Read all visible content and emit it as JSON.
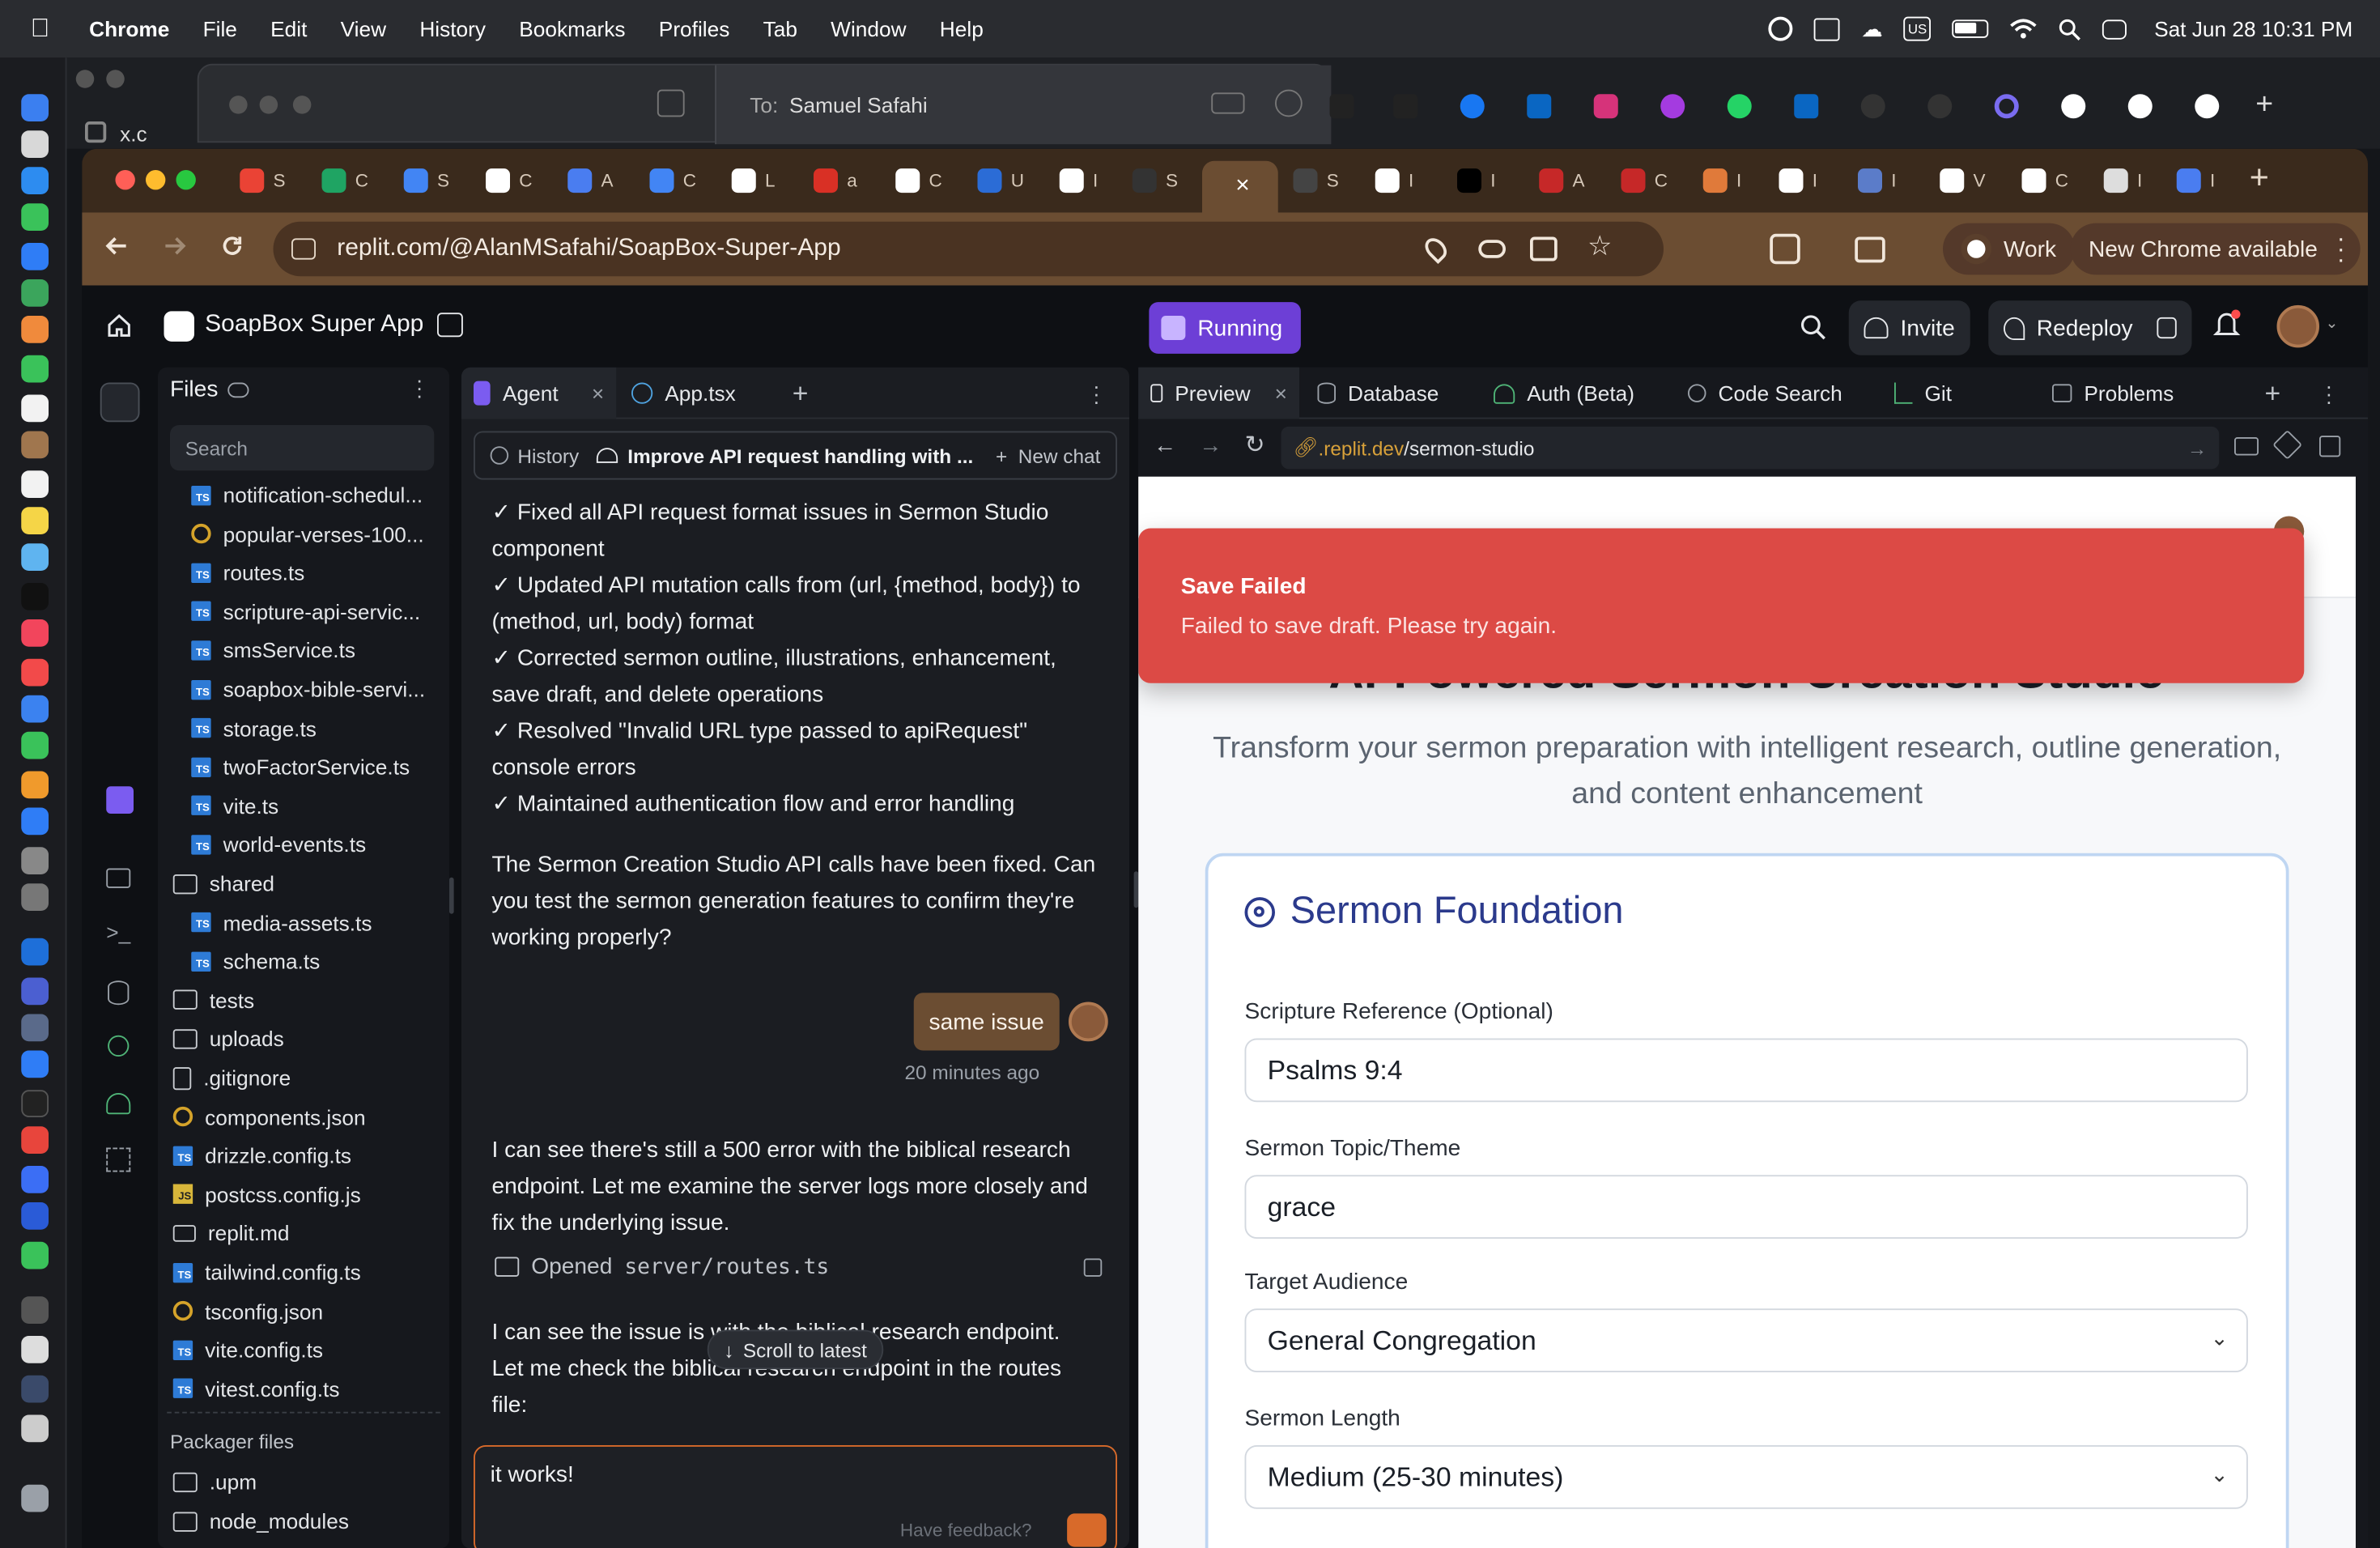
{
  "menubar": {
    "app": "Chrome",
    "items": [
      "File",
      "Edit",
      "View",
      "History",
      "Bookmarks",
      "Profiles",
      "Tab",
      "Window",
      "Help"
    ],
    "input_source": "US",
    "datetime": "Sat Jun 28  10:31 PM"
  },
  "background_window": {
    "partial_tab": "x.c",
    "message_to_label": "To:",
    "message_to_value": "Samuel Safahi"
  },
  "chrome": {
    "tabs_partial": [
      "S",
      "C",
      "S",
      "C",
      "A",
      "C",
      "L",
      "a",
      "C",
      "U",
      "I",
      "S",
      "S",
      "I",
      "I",
      "A",
      "C",
      "I",
      "I",
      "I",
      "V",
      "C",
      "I",
      "I"
    ],
    "address": "replit.com/@AlanMSafahi/SoapBox-Super-App",
    "profile_label": "Work",
    "update_label": "New Chrome available"
  },
  "replit": {
    "project_name": "SoapBox Super App",
    "run_status": "Running",
    "invite_label": "Invite",
    "redeploy_label": "Redeploy",
    "files": {
      "title": "Files",
      "search_placeholder": "Search",
      "items": [
        {
          "name": "notification-schedul...",
          "type": "ts"
        },
        {
          "name": "popular-verses-100...",
          "type": "json"
        },
        {
          "name": "routes.ts",
          "type": "ts"
        },
        {
          "name": "scripture-api-servic...",
          "type": "ts"
        },
        {
          "name": "smsService.ts",
          "type": "ts"
        },
        {
          "name": "soapbox-bible-servi...",
          "type": "ts"
        },
        {
          "name": "storage.ts",
          "type": "ts"
        },
        {
          "name": "twoFactorService.ts",
          "type": "ts"
        },
        {
          "name": "vite.ts",
          "type": "ts"
        },
        {
          "name": "world-events.ts",
          "type": "ts"
        },
        {
          "name": "shared",
          "type": "folder"
        },
        {
          "name": "media-assets.ts",
          "type": "ts"
        },
        {
          "name": "schema.ts",
          "type": "ts"
        },
        {
          "name": "tests",
          "type": "folder"
        },
        {
          "name": "uploads",
          "type": "folder"
        },
        {
          "name": ".gitignore",
          "type": "doc"
        },
        {
          "name": "components.json",
          "type": "json"
        },
        {
          "name": "drizzle.config.ts",
          "type": "ts"
        },
        {
          "name": "postcss.config.js",
          "type": "js"
        },
        {
          "name": "replit.md",
          "type": "md"
        },
        {
          "name": "tailwind.config.ts",
          "type": "ts"
        },
        {
          "name": "tsconfig.json",
          "type": "json"
        },
        {
          "name": "vite.config.ts",
          "type": "ts"
        },
        {
          "name": "vitest.config.ts",
          "type": "ts"
        }
      ],
      "packager_title": "Packager files",
      "packager_items": [
        ".upm",
        "node_modules"
      ]
    },
    "agent": {
      "tab_agent": "Agent",
      "tab_file": "App.tsx",
      "history_label": "History",
      "chat_title": "Improve API request handling with ...",
      "new_chat_label": "New chat",
      "checklist": [
        "✓ Fixed all API request format issues in Sermon Studio component",
        "✓ Updated API mutation calls from (url, {method, body}) to (method, url, body) format",
        "✓ Corrected sermon outline, illustrations, enhancement, save draft, and delete operations",
        "✓ Resolved \"Invalid URL type passed to apiRequest\" console errors",
        "✓ Maintained authentication flow and error handling"
      ],
      "summary": "The Sermon Creation Studio API calls have been fixed. Can you test the sermon generation features to confirm they're working properly?",
      "user_message": "same issue",
      "user_time": "20 minutes ago",
      "reply1": "I can see there's still a 500 error with the biblical research endpoint. Let me examine the server logs more closely and fix the underlying issue.",
      "opened_label": "Opened",
      "opened_file": "server/routes.ts",
      "reply2_a": "I can see the issue is with the biblical research endpoint.",
      "reply2_b": "Let me check the biblical research endpoint in the routes",
      "reply2_c": "file:",
      "scroll_label": "Scroll to latest",
      "input_value": "it works!",
      "feedback_label": "Have feedback?"
    },
    "preview": {
      "tabs": [
        "Preview",
        "Database",
        "Auth (Beta)",
        "Code Search",
        "Git",
        "Problems"
      ],
      "url_prefix": ".replit.dev",
      "url_path": "/sermon-studio",
      "toast_title": "Save Failed",
      "toast_body": "Failed to save draft. Please try again.",
      "page_title": "AI-Powered Sermon Creation Studio",
      "page_subtitle_1": "Transform your sermon preparation with intelligent research, outline generation,",
      "page_subtitle_2": "and content enhancement",
      "card_title": "Sermon Foundation",
      "fields": [
        {
          "label": "Scripture Reference (Optional)",
          "value": "Psalms 9:4"
        },
        {
          "label": "Sermon Topic/Theme",
          "value": "grace"
        },
        {
          "label": "Target Audience",
          "value": "General Congregation"
        },
        {
          "label": "Sermon Length",
          "value": "Medium (25-30 minutes)"
        }
      ]
    }
  },
  "colors": {
    "toast": "#dc4a45",
    "running": "#6d3fd6",
    "chrome_frame": "#6b4d32",
    "card_title": "#2b3a8c"
  }
}
